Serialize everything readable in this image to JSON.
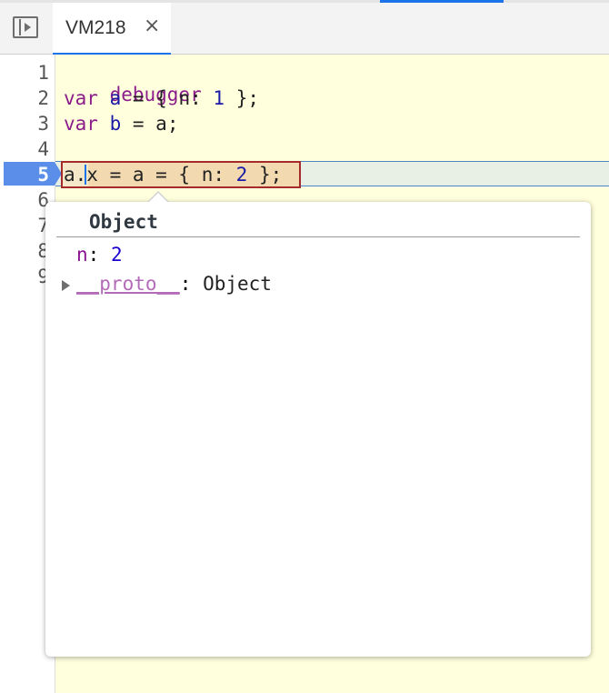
{
  "tab": {
    "filename": "VM218",
    "close_glyph": "×"
  },
  "icons": {
    "navigator": "navigator-toggle-icon",
    "expand": "triangle-right-icon"
  },
  "colors": {
    "accent": "#1a73e8",
    "editor_bg": "#ffffdd",
    "exec_marker": "#5a8ee8",
    "expr_border": "#a52a2a"
  },
  "gutter": {
    "line_numbers": [
      "1",
      "2",
      "3",
      "4",
      "5",
      "6",
      "7",
      "8",
      "9"
    ],
    "current_line": "5"
  },
  "code": {
    "line1": {
      "kw": "debugger"
    },
    "line2": {
      "kw": "var",
      "name": "a",
      "rest_a": " = { n: ",
      "num": "1",
      "rest_b": " };"
    },
    "line3": {
      "kw": "var",
      "name": "b",
      "rest": " = a;"
    },
    "line5": {
      "text_a": "a.x = a = { n: ",
      "num": "2",
      "text_b": " };"
    }
  },
  "popover": {
    "title": "Object",
    "props": [
      {
        "key": "n",
        "sep": ": ",
        "value": "2"
      },
      {
        "key": "__proto__",
        "sep": ": ",
        "value": "Object"
      }
    ]
  }
}
